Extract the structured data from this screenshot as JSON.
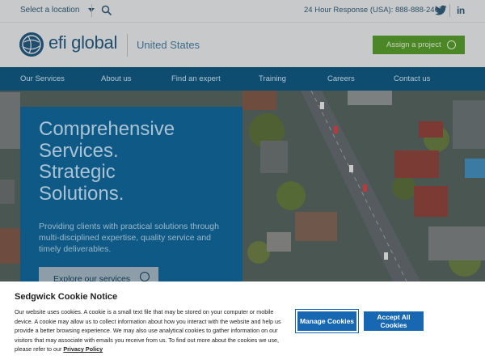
{
  "topbar": {
    "location_label": "Select a location",
    "phone": "24 Hour Response (USA): 888-888-2467",
    "social": {
      "linkedin": "in"
    }
  },
  "header": {
    "logo_text": "efi global",
    "country": "United States",
    "assign_label": "Assign a project"
  },
  "nav": {
    "items": [
      "Our Services",
      "About us",
      "Find an expert",
      "Training",
      "Careers",
      "Contact us"
    ]
  },
  "hero": {
    "headline": [
      "Comprehensive",
      "Services.",
      "Strategic",
      "Solutions."
    ],
    "subtitle": "Providing clients with practical solutions through multi-disciplined expertise, quality service and timely deliverables.",
    "cta_label": "Explore our services"
  },
  "cookie": {
    "title": "Sedgwick Cookie Notice",
    "body": "Our website uses cookies. A cookie is a small text file that may be stored on your computer or mobile device. A cookie may allow us to collect information about how you interact with the website and help us provide a better browsing experience. We may also use analytical cookies to gather information on our visitors that may associate with emails you receive from us. To find out more about the cookies we use, please refer to our",
    "link_label": "Privacy Policy",
    "manage_label": "Manage Cookies",
    "accept_label": "Accept All Cookies"
  },
  "colors": {
    "nav_bg": "#0f4d70",
    "hero_panel": "#0e5985",
    "assign_green": "#4b8726",
    "cookie_button": "#1767b2"
  }
}
